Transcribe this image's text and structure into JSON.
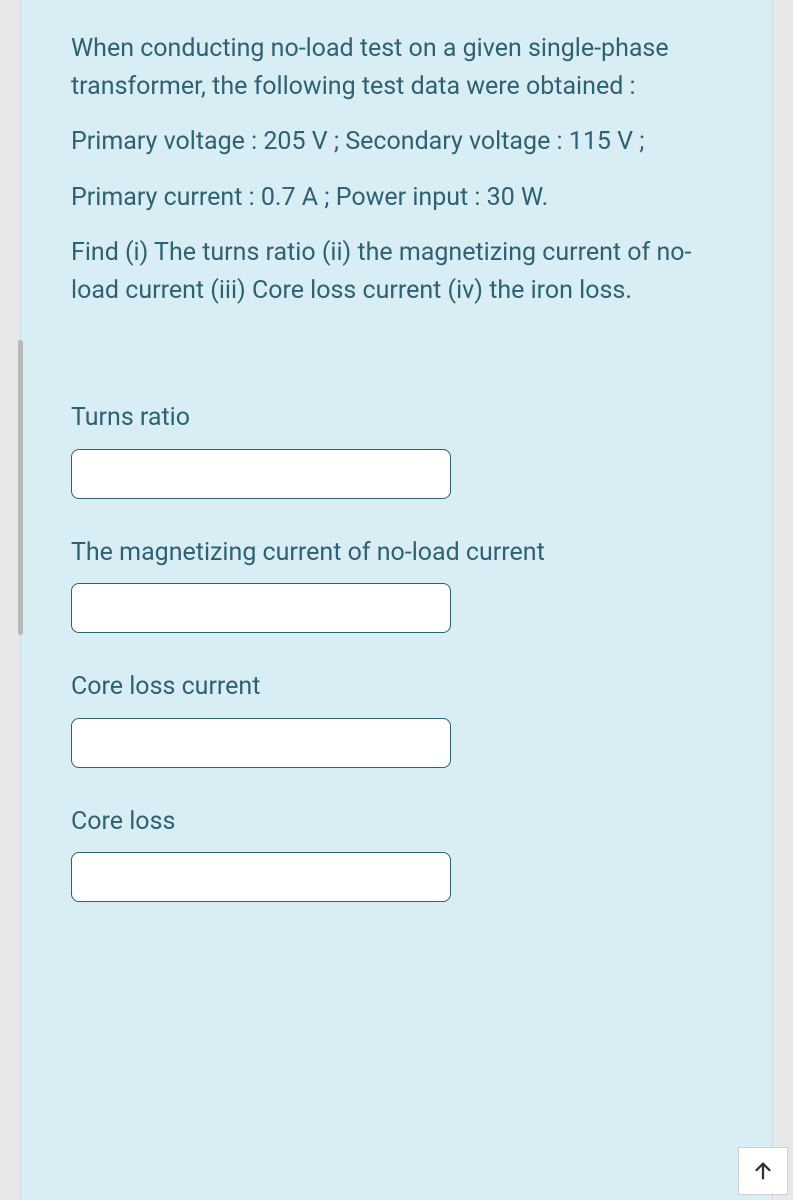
{
  "question": {
    "paragraphs": [
      "When conducting no-load test on a given single-phase transformer, the following test data were obtained :",
      "Primary voltage : 205 V ; Secondary voltage : 115 V ;",
      "Primary current : 0.7 A ; Power input : 30 W.",
      "Find (i) The turns ratio (ii) the magnetizing current of no-load current (iii) Core loss current (iv) the iron loss."
    ]
  },
  "fields": [
    {
      "label": "Turns ratio",
      "value": ""
    },
    {
      "label": "The magnetizing current of no-load current",
      "value": ""
    },
    {
      "label": "Core loss current",
      "value": ""
    },
    {
      "label": "Core loss",
      "value": ""
    }
  ]
}
